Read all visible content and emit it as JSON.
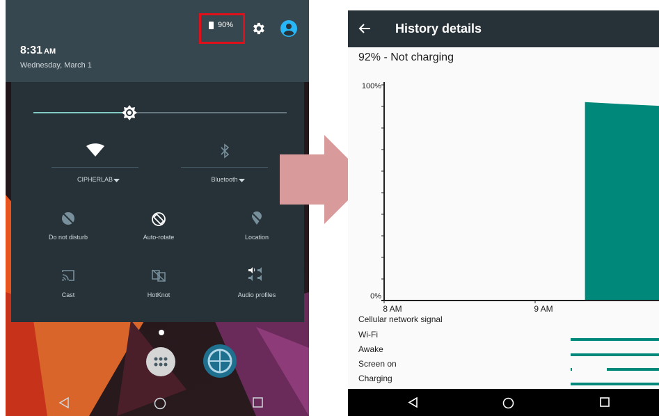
{
  "quick_settings": {
    "battery_percent": "90%",
    "time": "8:31",
    "ampm": "AM",
    "date": "Wednesday, March 1",
    "brightness_level": 0.38,
    "tiles": {
      "wifi": "CIPHERLAB",
      "bluetooth": "Bluetooth",
      "dnd": "Do not disturb",
      "autorotate": "Auto-rotate",
      "location": "Location",
      "cast": "Cast",
      "hotknot": "HotKnot",
      "audio": "Audio profiles"
    },
    "icons": [
      "battery-icon",
      "gear-icon",
      "account-icon",
      "brightness-icon",
      "wifi-icon",
      "bluetooth-icon",
      "dnd-icon",
      "autorotate-icon",
      "location-icon",
      "cast-icon",
      "hotknot-icon",
      "audio-profiles-icon",
      "apps-icon",
      "globe-icon"
    ],
    "highlight_color": "#e0101a"
  },
  "history": {
    "title": "History details",
    "status": "92% - Not charging",
    "legend": [
      "Cellular network signal",
      "Wi-Fi",
      "Awake",
      "Screen on",
      "Charging"
    ]
  },
  "chart_data": {
    "type": "area",
    "title": "",
    "y_ticks": [
      "100%",
      "0%"
    ],
    "x_ticks": [
      "8 AM",
      "9 AM"
    ],
    "ylim": [
      0,
      100
    ],
    "xlim": [
      7.95,
      10.05
    ],
    "series": [
      {
        "x": [
          9.33,
          9.33,
          9.6,
          9.9,
          10.05
        ],
        "y": [
          0,
          92,
          91,
          90,
          90
        ]
      }
    ],
    "color": "#00897b"
  }
}
